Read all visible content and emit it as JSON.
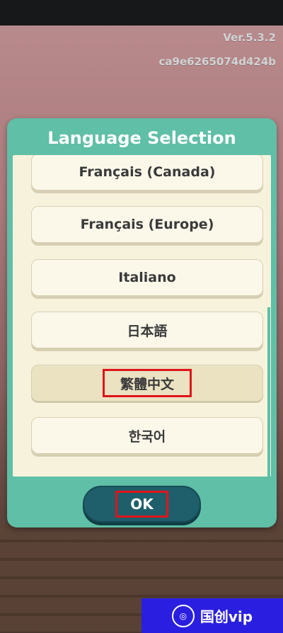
{
  "status": {
    "version": "Ver.5.3.2",
    "build_hash": "ca9e6265074d424b"
  },
  "dialog": {
    "title": "Language Selection",
    "languages": [
      {
        "label": "Français (Canada)"
      },
      {
        "label": "Français (Europe)"
      },
      {
        "label": "Italiano"
      },
      {
        "label": "日本語"
      },
      {
        "label": "繁體中文",
        "selected": true
      },
      {
        "label": "한국어"
      }
    ],
    "ok_label": "OK"
  },
  "watermark": {
    "text": "国创vip"
  },
  "colors": {
    "dialog_teal": "#5fbfa7",
    "list_cream": "#f7f2dc",
    "ok_button": "#1f5f6b",
    "highlight_red": "#e0141a"
  }
}
